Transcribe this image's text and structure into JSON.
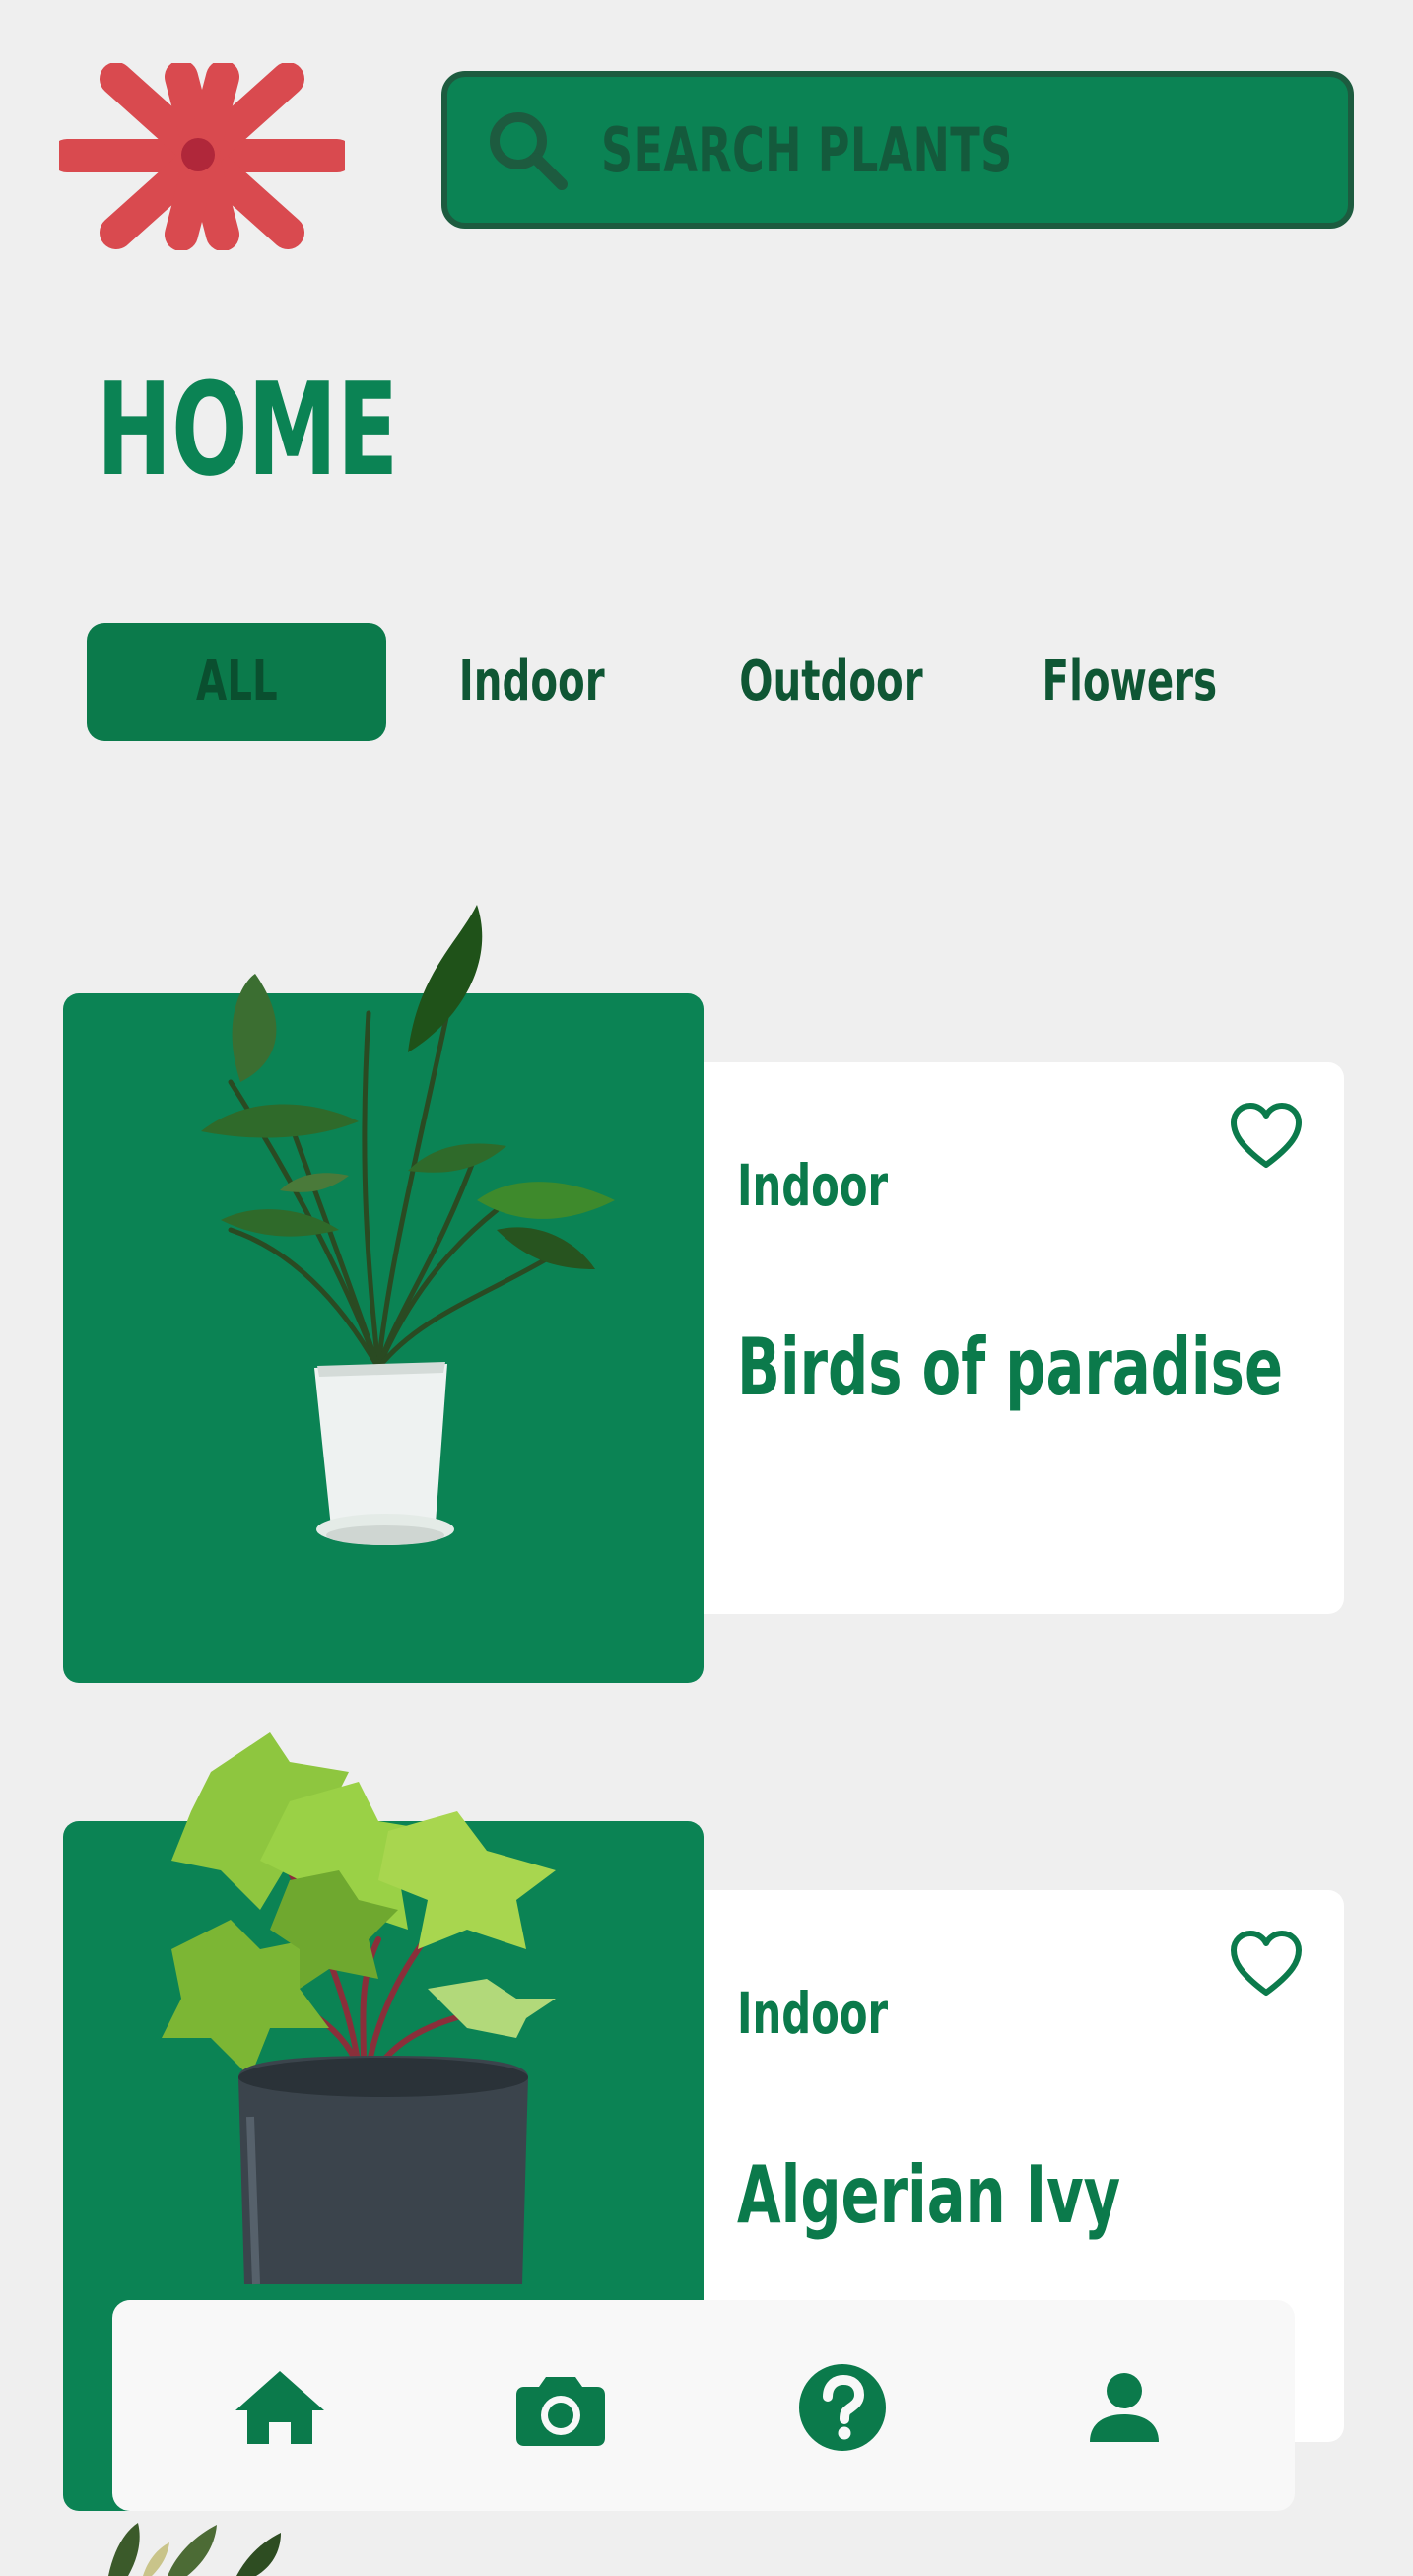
{
  "colors": {
    "accent": "#0b8354",
    "accent_dark": "#1d5b3f",
    "logo_red": "#d94a4f",
    "background": "#efefef"
  },
  "search": {
    "placeholder": "SEARCH PLANTS",
    "icon": "search-icon"
  },
  "page": {
    "title": "HOME"
  },
  "tabs": [
    {
      "label": "ALL",
      "active": true
    },
    {
      "label": "Indoor",
      "active": false
    },
    {
      "label": "Outdoor",
      "active": false
    },
    {
      "label": "Flowers",
      "active": false
    }
  ],
  "plants": [
    {
      "category": "Indoor",
      "name": "Birds of paradise",
      "image": "bird-of-paradise-plant",
      "favorite": false
    },
    {
      "category": "Indoor",
      "name": "Algerian Ivy",
      "image": "algerian-ivy-plant",
      "favorite": false
    }
  ],
  "bottom_nav": [
    {
      "icon": "home-icon",
      "active": true
    },
    {
      "icon": "camera-icon",
      "active": false
    },
    {
      "icon": "help-icon",
      "active": false
    },
    {
      "icon": "profile-icon",
      "active": false
    }
  ]
}
